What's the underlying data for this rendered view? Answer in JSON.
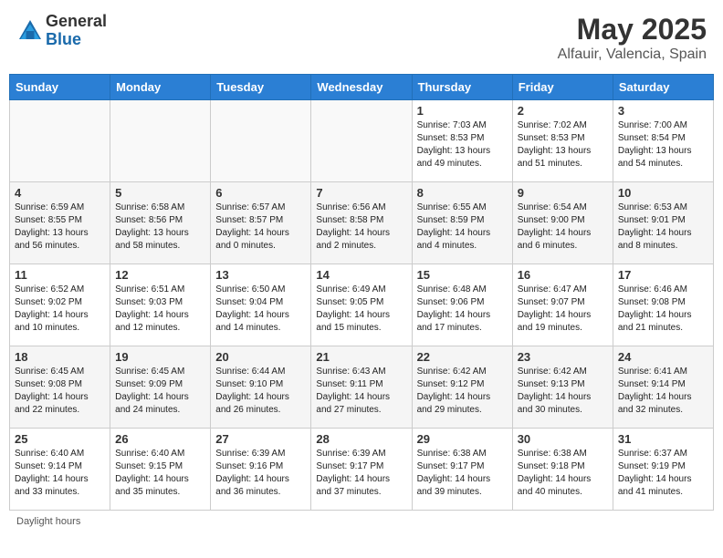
{
  "header": {
    "logo_general": "General",
    "logo_blue": "Blue",
    "month_title": "May 2025",
    "location": "Alfauir, Valencia, Spain"
  },
  "footer": {
    "daylight_label": "Daylight hours"
  },
  "weekdays": [
    "Sunday",
    "Monday",
    "Tuesday",
    "Wednesday",
    "Thursday",
    "Friday",
    "Saturday"
  ],
  "weeks": [
    [
      {
        "day": "",
        "info": ""
      },
      {
        "day": "",
        "info": ""
      },
      {
        "day": "",
        "info": ""
      },
      {
        "day": "",
        "info": ""
      },
      {
        "day": "1",
        "info": "Sunrise: 7:03 AM\nSunset: 8:53 PM\nDaylight: 13 hours\nand 49 minutes."
      },
      {
        "day": "2",
        "info": "Sunrise: 7:02 AM\nSunset: 8:53 PM\nDaylight: 13 hours\nand 51 minutes."
      },
      {
        "day": "3",
        "info": "Sunrise: 7:00 AM\nSunset: 8:54 PM\nDaylight: 13 hours\nand 54 minutes."
      }
    ],
    [
      {
        "day": "4",
        "info": "Sunrise: 6:59 AM\nSunset: 8:55 PM\nDaylight: 13 hours\nand 56 minutes."
      },
      {
        "day": "5",
        "info": "Sunrise: 6:58 AM\nSunset: 8:56 PM\nDaylight: 13 hours\nand 58 minutes."
      },
      {
        "day": "6",
        "info": "Sunrise: 6:57 AM\nSunset: 8:57 PM\nDaylight: 14 hours\nand 0 minutes."
      },
      {
        "day": "7",
        "info": "Sunrise: 6:56 AM\nSunset: 8:58 PM\nDaylight: 14 hours\nand 2 minutes."
      },
      {
        "day": "8",
        "info": "Sunrise: 6:55 AM\nSunset: 8:59 PM\nDaylight: 14 hours\nand 4 minutes."
      },
      {
        "day": "9",
        "info": "Sunrise: 6:54 AM\nSunset: 9:00 PM\nDaylight: 14 hours\nand 6 minutes."
      },
      {
        "day": "10",
        "info": "Sunrise: 6:53 AM\nSunset: 9:01 PM\nDaylight: 14 hours\nand 8 minutes."
      }
    ],
    [
      {
        "day": "11",
        "info": "Sunrise: 6:52 AM\nSunset: 9:02 PM\nDaylight: 14 hours\nand 10 minutes."
      },
      {
        "day": "12",
        "info": "Sunrise: 6:51 AM\nSunset: 9:03 PM\nDaylight: 14 hours\nand 12 minutes."
      },
      {
        "day": "13",
        "info": "Sunrise: 6:50 AM\nSunset: 9:04 PM\nDaylight: 14 hours\nand 14 minutes."
      },
      {
        "day": "14",
        "info": "Sunrise: 6:49 AM\nSunset: 9:05 PM\nDaylight: 14 hours\nand 15 minutes."
      },
      {
        "day": "15",
        "info": "Sunrise: 6:48 AM\nSunset: 9:06 PM\nDaylight: 14 hours\nand 17 minutes."
      },
      {
        "day": "16",
        "info": "Sunrise: 6:47 AM\nSunset: 9:07 PM\nDaylight: 14 hours\nand 19 minutes."
      },
      {
        "day": "17",
        "info": "Sunrise: 6:46 AM\nSunset: 9:08 PM\nDaylight: 14 hours\nand 21 minutes."
      }
    ],
    [
      {
        "day": "18",
        "info": "Sunrise: 6:45 AM\nSunset: 9:08 PM\nDaylight: 14 hours\nand 22 minutes."
      },
      {
        "day": "19",
        "info": "Sunrise: 6:45 AM\nSunset: 9:09 PM\nDaylight: 14 hours\nand 24 minutes."
      },
      {
        "day": "20",
        "info": "Sunrise: 6:44 AM\nSunset: 9:10 PM\nDaylight: 14 hours\nand 26 minutes."
      },
      {
        "day": "21",
        "info": "Sunrise: 6:43 AM\nSunset: 9:11 PM\nDaylight: 14 hours\nand 27 minutes."
      },
      {
        "day": "22",
        "info": "Sunrise: 6:42 AM\nSunset: 9:12 PM\nDaylight: 14 hours\nand 29 minutes."
      },
      {
        "day": "23",
        "info": "Sunrise: 6:42 AM\nSunset: 9:13 PM\nDaylight: 14 hours\nand 30 minutes."
      },
      {
        "day": "24",
        "info": "Sunrise: 6:41 AM\nSunset: 9:14 PM\nDaylight: 14 hours\nand 32 minutes."
      }
    ],
    [
      {
        "day": "25",
        "info": "Sunrise: 6:40 AM\nSunset: 9:14 PM\nDaylight: 14 hours\nand 33 minutes."
      },
      {
        "day": "26",
        "info": "Sunrise: 6:40 AM\nSunset: 9:15 PM\nDaylight: 14 hours\nand 35 minutes."
      },
      {
        "day": "27",
        "info": "Sunrise: 6:39 AM\nSunset: 9:16 PM\nDaylight: 14 hours\nand 36 minutes."
      },
      {
        "day": "28",
        "info": "Sunrise: 6:39 AM\nSunset: 9:17 PM\nDaylight: 14 hours\nand 37 minutes."
      },
      {
        "day": "29",
        "info": "Sunrise: 6:38 AM\nSunset: 9:17 PM\nDaylight: 14 hours\nand 39 minutes."
      },
      {
        "day": "30",
        "info": "Sunrise: 6:38 AM\nSunset: 9:18 PM\nDaylight: 14 hours\nand 40 minutes."
      },
      {
        "day": "31",
        "info": "Sunrise: 6:37 AM\nSunset: 9:19 PM\nDaylight: 14 hours\nand 41 minutes."
      }
    ]
  ]
}
